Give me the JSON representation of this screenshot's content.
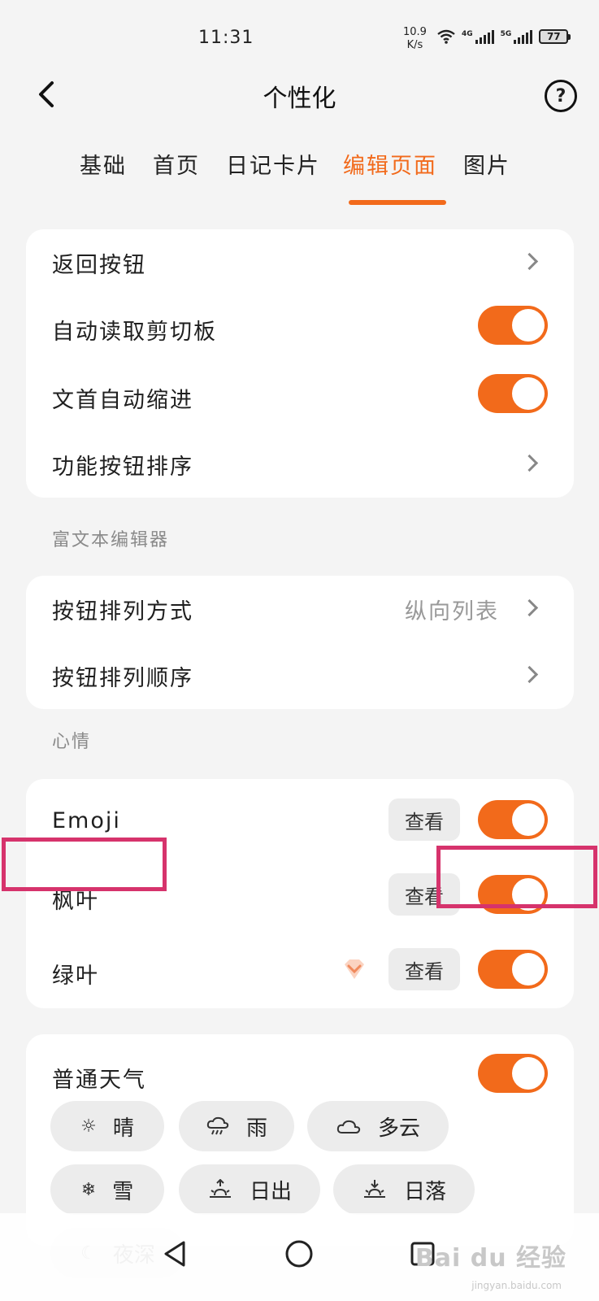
{
  "status": {
    "time": "11:31",
    "net_speed": "10.9",
    "net_unit": "K/s",
    "sim1": "4G",
    "sim2": "5G",
    "battery": "77"
  },
  "header": {
    "title": "个性化",
    "back_icon": "back-arrow-icon",
    "help_icon": "help-icon"
  },
  "tabs": [
    {
      "label": "基础",
      "active": false
    },
    {
      "label": "首页",
      "active": false
    },
    {
      "label": "日记卡片",
      "active": false
    },
    {
      "label": "编辑页面",
      "active": true
    },
    {
      "label": "图片",
      "active": false
    }
  ],
  "card1": {
    "rows": [
      {
        "label": "返回按钮",
        "control": "chevron"
      },
      {
        "label": "自动读取剪切板",
        "control": "toggle",
        "on": true
      },
      {
        "label": "文首自动缩进",
        "control": "toggle",
        "on": true
      },
      {
        "label": "功能按钮排序",
        "control": "chevron"
      }
    ]
  },
  "rich_text": {
    "section_label": "富文本编辑器",
    "rows": [
      {
        "label": "按钮排列方式",
        "value": "纵向列表",
        "control": "chevron"
      },
      {
        "label": "按钮排列顺序",
        "control": "chevron"
      }
    ]
  },
  "mood": {
    "section_label": "心情",
    "view_label": "查看",
    "rows": [
      {
        "label": "Emoji",
        "on": true,
        "vip": false
      },
      {
        "label": "枫叶",
        "on": true,
        "vip": false
      },
      {
        "label": "绿叶",
        "on": true,
        "vip": true
      }
    ]
  },
  "weather": {
    "row_label": "普通天气",
    "on": true,
    "chips": [
      {
        "label": "晴",
        "icon": "sun-icon"
      },
      {
        "label": "雨",
        "icon": "rain-cloud-icon"
      },
      {
        "label": "多云",
        "icon": "cloud-icon"
      },
      {
        "label": "雪",
        "icon": "snowflake-icon"
      },
      {
        "label": "日出",
        "icon": "sunrise-icon"
      },
      {
        "label": "日落",
        "icon": "sunset-icon"
      },
      {
        "label": "夜深",
        "icon": "moon-icon"
      }
    ]
  },
  "colors": {
    "accent": "#f26a1b",
    "highlight": "#d6336c"
  },
  "watermark": {
    "text": "Bai du 经验",
    "sub": "jingyan.baidu.com"
  }
}
